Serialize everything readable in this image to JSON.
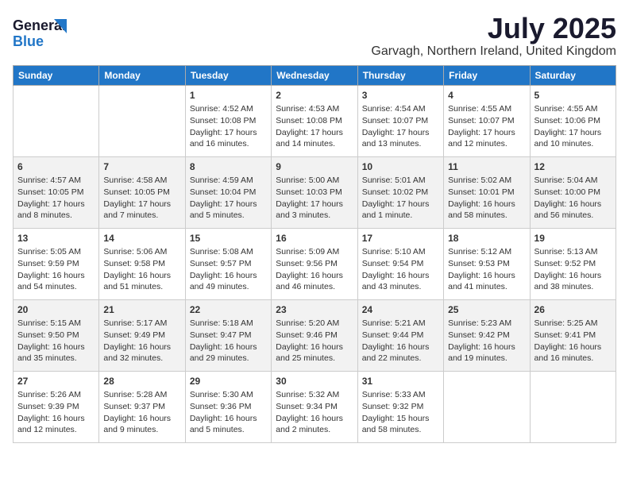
{
  "header": {
    "logo_line1": "General",
    "logo_line2": "Blue",
    "month": "July 2025",
    "location": "Garvagh, Northern Ireland, United Kingdom"
  },
  "weekdays": [
    "Sunday",
    "Monday",
    "Tuesday",
    "Wednesday",
    "Thursday",
    "Friday",
    "Saturday"
  ],
  "weeks": [
    [
      {
        "day": "",
        "content": ""
      },
      {
        "day": "",
        "content": ""
      },
      {
        "day": "1",
        "content": "Sunrise: 4:52 AM\nSunset: 10:08 PM\nDaylight: 17 hours\nand 16 minutes."
      },
      {
        "day": "2",
        "content": "Sunrise: 4:53 AM\nSunset: 10:08 PM\nDaylight: 17 hours\nand 14 minutes."
      },
      {
        "day": "3",
        "content": "Sunrise: 4:54 AM\nSunset: 10:07 PM\nDaylight: 17 hours\nand 13 minutes."
      },
      {
        "day": "4",
        "content": "Sunrise: 4:55 AM\nSunset: 10:07 PM\nDaylight: 17 hours\nand 12 minutes."
      },
      {
        "day": "5",
        "content": "Sunrise: 4:55 AM\nSunset: 10:06 PM\nDaylight: 17 hours\nand 10 minutes."
      }
    ],
    [
      {
        "day": "6",
        "content": "Sunrise: 4:57 AM\nSunset: 10:05 PM\nDaylight: 17 hours\nand 8 minutes."
      },
      {
        "day": "7",
        "content": "Sunrise: 4:58 AM\nSunset: 10:05 PM\nDaylight: 17 hours\nand 7 minutes."
      },
      {
        "day": "8",
        "content": "Sunrise: 4:59 AM\nSunset: 10:04 PM\nDaylight: 17 hours\nand 5 minutes."
      },
      {
        "day": "9",
        "content": "Sunrise: 5:00 AM\nSunset: 10:03 PM\nDaylight: 17 hours\nand 3 minutes."
      },
      {
        "day": "10",
        "content": "Sunrise: 5:01 AM\nSunset: 10:02 PM\nDaylight: 17 hours\nand 1 minute."
      },
      {
        "day": "11",
        "content": "Sunrise: 5:02 AM\nSunset: 10:01 PM\nDaylight: 16 hours\nand 58 minutes."
      },
      {
        "day": "12",
        "content": "Sunrise: 5:04 AM\nSunset: 10:00 PM\nDaylight: 16 hours\nand 56 minutes."
      }
    ],
    [
      {
        "day": "13",
        "content": "Sunrise: 5:05 AM\nSunset: 9:59 PM\nDaylight: 16 hours\nand 54 minutes."
      },
      {
        "day": "14",
        "content": "Sunrise: 5:06 AM\nSunset: 9:58 PM\nDaylight: 16 hours\nand 51 minutes."
      },
      {
        "day": "15",
        "content": "Sunrise: 5:08 AM\nSunset: 9:57 PM\nDaylight: 16 hours\nand 49 minutes."
      },
      {
        "day": "16",
        "content": "Sunrise: 5:09 AM\nSunset: 9:56 PM\nDaylight: 16 hours\nand 46 minutes."
      },
      {
        "day": "17",
        "content": "Sunrise: 5:10 AM\nSunset: 9:54 PM\nDaylight: 16 hours\nand 43 minutes."
      },
      {
        "day": "18",
        "content": "Sunrise: 5:12 AM\nSunset: 9:53 PM\nDaylight: 16 hours\nand 41 minutes."
      },
      {
        "day": "19",
        "content": "Sunrise: 5:13 AM\nSunset: 9:52 PM\nDaylight: 16 hours\nand 38 minutes."
      }
    ],
    [
      {
        "day": "20",
        "content": "Sunrise: 5:15 AM\nSunset: 9:50 PM\nDaylight: 16 hours\nand 35 minutes."
      },
      {
        "day": "21",
        "content": "Sunrise: 5:17 AM\nSunset: 9:49 PM\nDaylight: 16 hours\nand 32 minutes."
      },
      {
        "day": "22",
        "content": "Sunrise: 5:18 AM\nSunset: 9:47 PM\nDaylight: 16 hours\nand 29 minutes."
      },
      {
        "day": "23",
        "content": "Sunrise: 5:20 AM\nSunset: 9:46 PM\nDaylight: 16 hours\nand 25 minutes."
      },
      {
        "day": "24",
        "content": "Sunrise: 5:21 AM\nSunset: 9:44 PM\nDaylight: 16 hours\nand 22 minutes."
      },
      {
        "day": "25",
        "content": "Sunrise: 5:23 AM\nSunset: 9:42 PM\nDaylight: 16 hours\nand 19 minutes."
      },
      {
        "day": "26",
        "content": "Sunrise: 5:25 AM\nSunset: 9:41 PM\nDaylight: 16 hours\nand 16 minutes."
      }
    ],
    [
      {
        "day": "27",
        "content": "Sunrise: 5:26 AM\nSunset: 9:39 PM\nDaylight: 16 hours\nand 12 minutes."
      },
      {
        "day": "28",
        "content": "Sunrise: 5:28 AM\nSunset: 9:37 PM\nDaylight: 16 hours\nand 9 minutes."
      },
      {
        "day": "29",
        "content": "Sunrise: 5:30 AM\nSunset: 9:36 PM\nDaylight: 16 hours\nand 5 minutes."
      },
      {
        "day": "30",
        "content": "Sunrise: 5:32 AM\nSunset: 9:34 PM\nDaylight: 16 hours\nand 2 minutes."
      },
      {
        "day": "31",
        "content": "Sunrise: 5:33 AM\nSunset: 9:32 PM\nDaylight: 15 hours\nand 58 minutes."
      },
      {
        "day": "",
        "content": ""
      },
      {
        "day": "",
        "content": ""
      }
    ]
  ]
}
